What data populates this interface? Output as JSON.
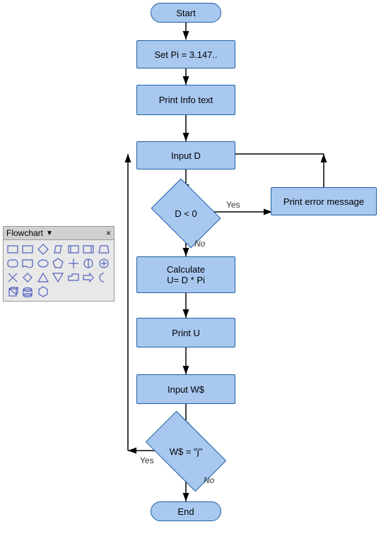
{
  "panel": {
    "title": "Flowchart",
    "arrow": "▼",
    "close": "×"
  },
  "nodes": {
    "start": {
      "label": "Start"
    },
    "set_pi": {
      "label": "Set Pi = 3.147.."
    },
    "print_info": {
      "label": "Print Info text"
    },
    "input_d": {
      "label": "Input D"
    },
    "d_lt_0": {
      "label": "D < 0"
    },
    "print_error": {
      "label": "Print error message"
    },
    "calculate": {
      "label": "Calculate\nU= D * Pi"
    },
    "print_u": {
      "label": "Print U"
    },
    "input_w": {
      "label": "Input W$"
    },
    "w_eq_j": {
      "label": "W$ = \"j\""
    },
    "end": {
      "label": "End"
    }
  },
  "labels": {
    "yes1": "Yes",
    "no1": "No",
    "yes2": "Yes",
    "no2": "No"
  }
}
